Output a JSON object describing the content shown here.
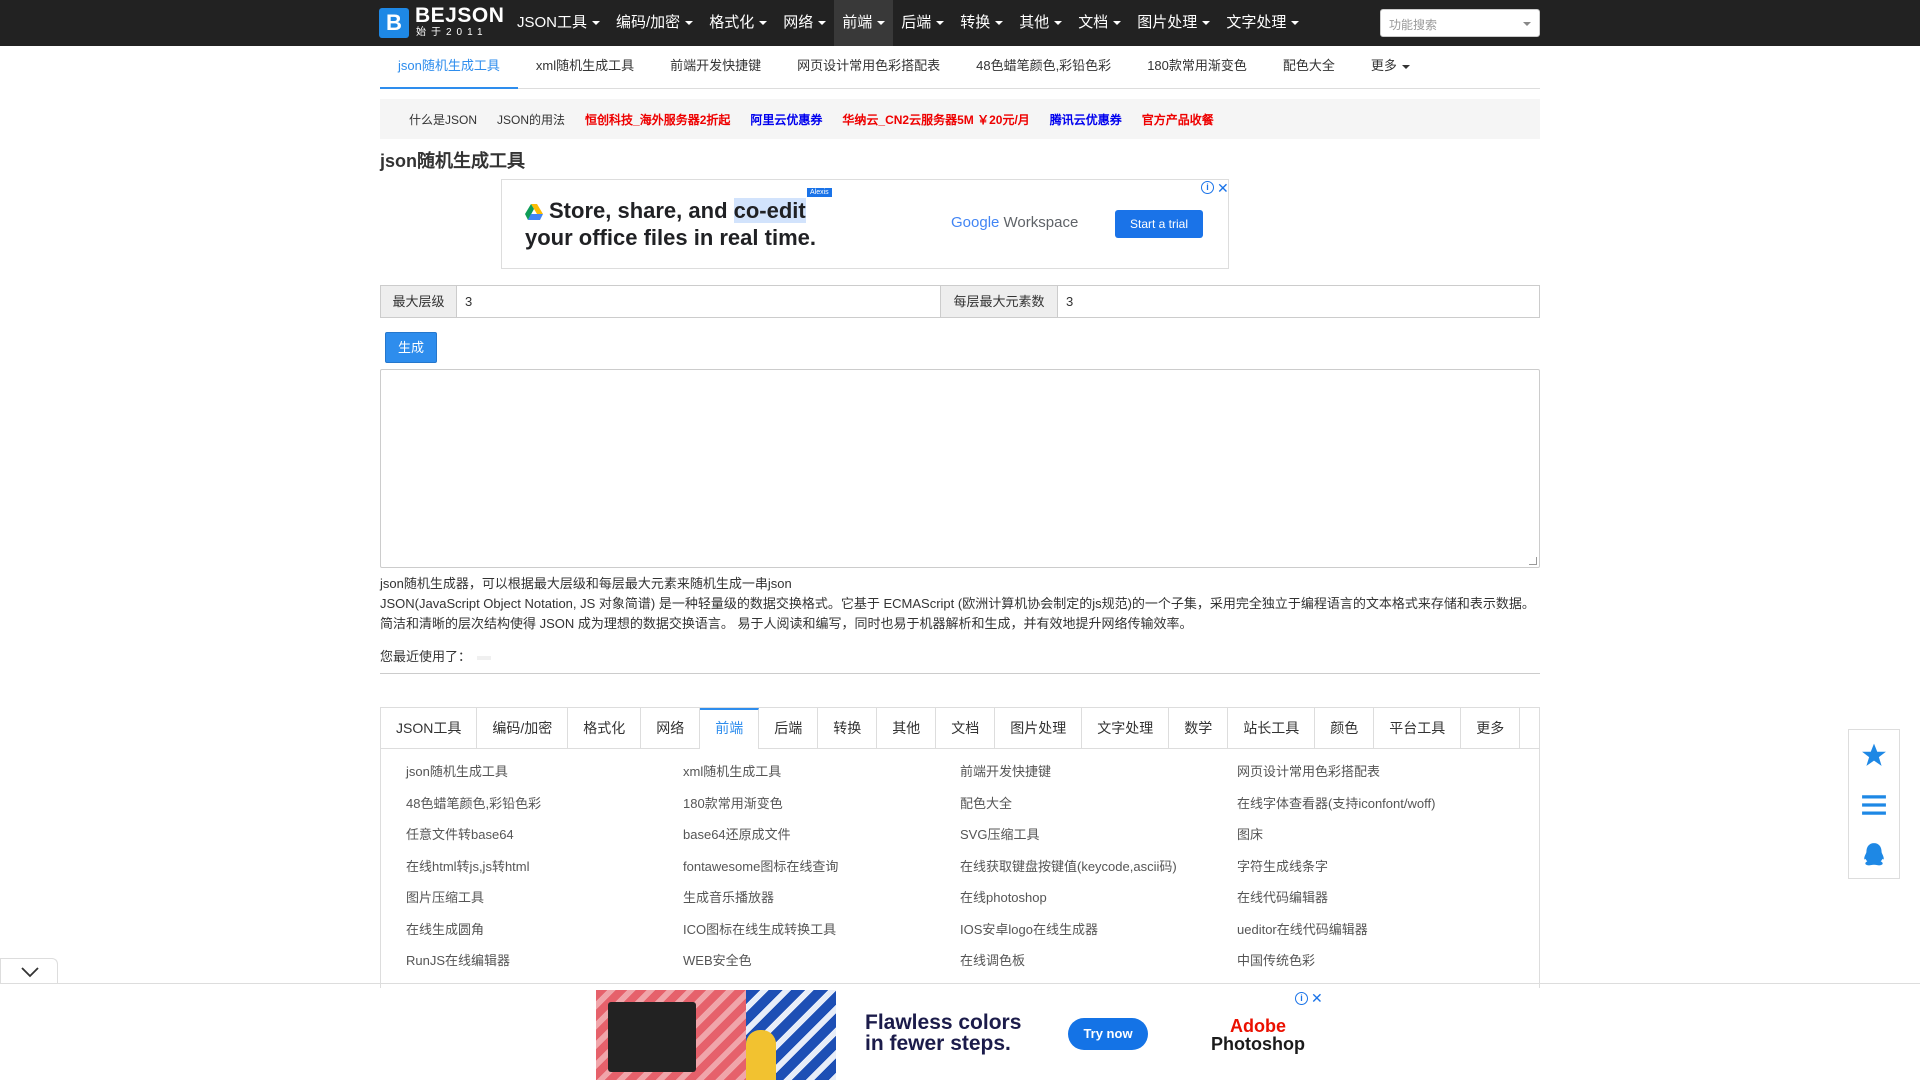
{
  "logo": {
    "text": "BEJSON",
    "mark": "B",
    "sub": "始于2011"
  },
  "nav": [
    {
      "label": "JSON工具"
    },
    {
      "label": "编码/加密"
    },
    {
      "label": "格式化"
    },
    {
      "label": "网络"
    },
    {
      "label": "前端",
      "active": true
    },
    {
      "label": "后端"
    },
    {
      "label": "转换"
    },
    {
      "label": "其他"
    },
    {
      "label": "文档"
    },
    {
      "label": "图片处理"
    },
    {
      "label": "文字处理"
    }
  ],
  "search": {
    "placeholder": "功能搜索"
  },
  "subtabs": [
    {
      "label": "json随机生成工具",
      "active": true
    },
    {
      "label": "xml随机生成工具"
    },
    {
      "label": "前端开发快捷键"
    },
    {
      "label": "网页设计常用色彩搭配表"
    },
    {
      "label": "48色蜡笔颜色,彩铅色彩"
    },
    {
      "label": "180款常用渐变色"
    },
    {
      "label": "配色大全"
    },
    {
      "label": "更多"
    }
  ],
  "links": [
    {
      "label": "什么是JSON",
      "style": "plain"
    },
    {
      "label": "JSON的用法",
      "style": "plain"
    },
    {
      "label": "恒创科技_海外服务器2折起",
      "style": "red"
    },
    {
      "label": "阿里云优惠券",
      "style": "blue"
    },
    {
      "label": "华纳云_CN2云服务器5M ￥20元/月",
      "style": "red"
    },
    {
      "label": "腾讯云优惠券",
      "style": "blue"
    },
    {
      "label": "官方产品收餐",
      "style": "red"
    }
  ],
  "page_title": "json随机生成工具",
  "ad_top": {
    "line1a": "Store, share, and ",
    "line1b": "co-edit",
    "line2": "your office files in real time.",
    "tag": "Alexis",
    "brand_g": "Google",
    "brand_w": " Workspace",
    "cta": "Start a trial"
  },
  "form": {
    "max_depth_label": "最大层级",
    "max_depth_value": "3",
    "max_items_label": "每层最大元素数",
    "max_items_value": "3"
  },
  "generate_button": "生成",
  "description": {
    "line1": "json随机生成器，可以根据最大层级和每层最大元素来随机生成一串json",
    "line2": "JSON(JavaScript Object Notation, JS 对象简谱) 是一种轻量级的数据交换格式。它基于 ECMAScript (欧洲计算机协会制定的js规范)的一个子集，采用完全独立于编程语言的文本格式来存储和表示数据。",
    "line3": "简洁和清晰的层次结构使得 JSON 成为理想的数据交换语言。 易于人阅读和编写，同时也易于机器解析和生成，并有效地提升网络传输效率。"
  },
  "recent_label": "您最近使用了：",
  "category_tabs": [
    {
      "label": "JSON工具"
    },
    {
      "label": "编码/加密"
    },
    {
      "label": "格式化"
    },
    {
      "label": "网络"
    },
    {
      "label": "前端",
      "active": true
    },
    {
      "label": "后端"
    },
    {
      "label": "转换"
    },
    {
      "label": "其他"
    },
    {
      "label": "文档"
    },
    {
      "label": "图片处理"
    },
    {
      "label": "文字处理"
    },
    {
      "label": "数学"
    },
    {
      "label": "站长工具"
    },
    {
      "label": "颜色"
    },
    {
      "label": "平台工具"
    },
    {
      "label": "更多"
    }
  ],
  "tools": [
    "json随机生成工具",
    "xml随机生成工具",
    "前端开发快捷键",
    "网页设计常用色彩搭配表",
    "48色蜡笔颜色,彩铅色彩",
    "180款常用渐变色",
    "配色大全",
    "在线字体查看器(支持iconfont/woff)",
    "任意文件转base64",
    "base64还原成文件",
    "SVG压缩工具",
    "图床",
    "在线html转js,js转html",
    "fontawesome图标在线查询",
    "在线获取键盘按键值(keycode,ascii码)",
    "字符生成线条字",
    "图片压缩工具",
    "生成音乐播放器",
    "在线photoshop",
    "在线代码编辑器",
    "在线生成圆角",
    "ICO图标在线生成转换工具",
    "IOS安卓logo在线生成器",
    "ueditor在线代码编辑器",
    "RunJS在线编辑器",
    "WEB安全色",
    "在线调色板",
    "中国传统色彩"
  ],
  "float_buttons": [
    {
      "icon": "star-icon"
    },
    {
      "icon": "menu-icon"
    },
    {
      "icon": "qq-icon"
    }
  ],
  "ad_bottom": {
    "headline1": "Flawless colors",
    "headline2": "in fewer steps.",
    "cta": "Try now",
    "brand1": "Adobe",
    "brand2": "Photoshop"
  },
  "colors": {
    "accent": "#2e8ded",
    "topbar": "#222222",
    "link_red": "#ee0000",
    "link_blue": "#0000ee"
  }
}
